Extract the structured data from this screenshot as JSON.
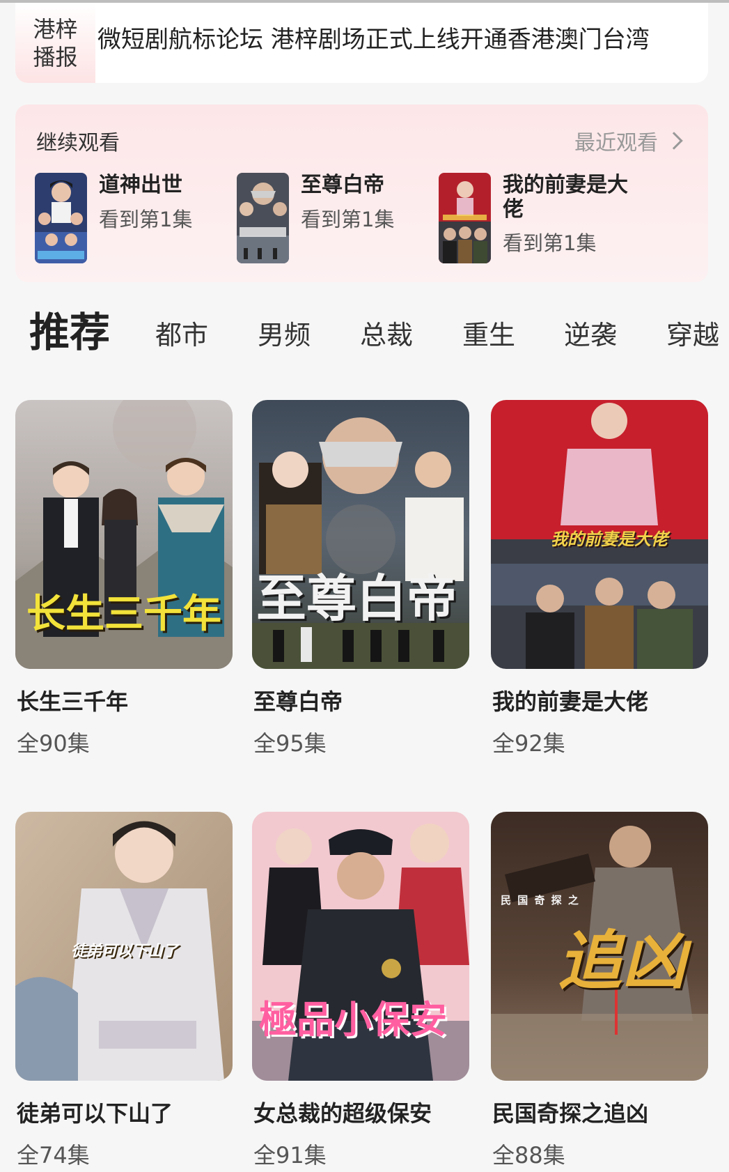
{
  "ticker": {
    "badge_line1": "港梓",
    "badge_line2": "播报",
    "text": "微短剧航标论坛 港梓剧场正式上线开通香港澳门台湾"
  },
  "continue_watching": {
    "title": "继续观看",
    "recent_label": "最近观看",
    "items": [
      {
        "name": "道神出世",
        "progress": "看到第1集"
      },
      {
        "name": "至尊白帝",
        "progress": "看到第1集"
      },
      {
        "name": "我的前妻是大佬",
        "progress": "看到第1集"
      }
    ]
  },
  "tabs": [
    "推荐",
    "都市",
    "男频",
    "总裁",
    "重生",
    "逆袭",
    "穿越"
  ],
  "dramas": [
    {
      "title": "长生三千年",
      "episodes": "全90集",
      "poster_text": "长生三千年",
      "accent": "#f2e23a"
    },
    {
      "title": "至尊白帝",
      "episodes": "全95集",
      "poster_text": "至尊白帝",
      "accent": "#f5f5f5"
    },
    {
      "title": "我的前妻是大佬",
      "episodes": "全92集",
      "poster_text": "我的前妻是大佬",
      "accent": "#f2d24a"
    },
    {
      "title": "徒弟可以下山了",
      "episodes": "全74集",
      "poster_text": "徒弟可以下山了",
      "accent": "#ffffff"
    },
    {
      "title": "女总裁的超级保安",
      "episodes": "全91集",
      "poster_text": "極品小保安",
      "accent": "#ff5fa0"
    },
    {
      "title": "民国奇探之追凶",
      "episodes": "全88集",
      "poster_text": "追凶",
      "poster_subtext": "民 国 奇 探 之",
      "accent": "#e8b13a"
    }
  ]
}
